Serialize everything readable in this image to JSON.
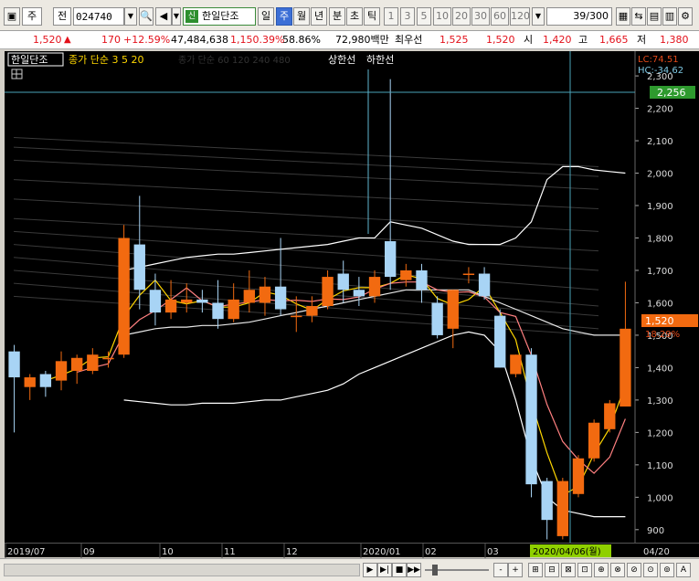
{
  "toolbar": {
    "market_label": "주",
    "type_label": "전",
    "code_value": "024740",
    "stock_name": "한일단조",
    "new_badge": "신",
    "periods": [
      "일",
      "주",
      "월",
      "년"
    ],
    "selected_period": "주",
    "minute_labels": [
      "분",
      "초",
      "틱"
    ],
    "intervals": [
      "1",
      "3",
      "5",
      "10",
      "20",
      "30",
      "60",
      "120"
    ],
    "count_value": "39/300"
  },
  "quote": {
    "price": "1,520",
    "change": "170",
    "change_pct": "+12.59%",
    "volume": "47,484,638",
    "volume_ratio": "1,150.39%",
    "turnover": "58.86%",
    "amount": "72,980백만",
    "best_ask_label": "최우선",
    "best_ask": "1,525",
    "best_bid": "1,520",
    "open_label": "시",
    "open": "1,420",
    "high_label": "고",
    "high": "1,665",
    "low_label": "저",
    "low": "1,380"
  },
  "legend": {
    "name": "한일단조",
    "ma_label": "종가 단순 3 5 20",
    "ma_label2": "종가 단순 60 120 240 480",
    "upper": "상한선",
    "lower": "하한선"
  },
  "axis_info": {
    "lc": "LC:74.51",
    "hc": "HC:-34.62",
    "crosshair_price": "2,256",
    "current_price": "1,520",
    "current_pct": "18.29%",
    "crosshair_date": "2020/04/06(월)"
  },
  "chart_data": {
    "type": "candlestick",
    "period": "weekly",
    "ylim": [
      860,
      2320
    ],
    "y_ticks": [
      900,
      1000,
      1100,
      1200,
      1300,
      1400,
      1500,
      1600,
      1700,
      1800,
      1900,
      2000,
      2100,
      2200,
      2300
    ],
    "x_labels": [
      "2019/07",
      "09",
      "10",
      "11",
      "12",
      "2020/01",
      "02",
      "03",
      "04/20"
    ],
    "candles": [
      {
        "o": 1450,
        "h": 1470,
        "l": 1200,
        "c": 1370
      },
      {
        "o": 1340,
        "h": 1380,
        "l": 1300,
        "c": 1370
      },
      {
        "o": 1380,
        "h": 1390,
        "l": 1310,
        "c": 1340
      },
      {
        "o": 1360,
        "h": 1450,
        "l": 1330,
        "c": 1420
      },
      {
        "o": 1390,
        "h": 1440,
        "l": 1350,
        "c": 1430
      },
      {
        "o": 1390,
        "h": 1460,
        "l": 1380,
        "c": 1440
      },
      {
        "o": 1430,
        "h": 1450,
        "l": 1400,
        "c": 1430
      },
      {
        "o": 1440,
        "h": 1840,
        "l": 1430,
        "c": 1800
      },
      {
        "o": 1780,
        "h": 1930,
        "l": 1580,
        "c": 1640
      },
      {
        "o": 1640,
        "h": 1690,
        "l": 1530,
        "c": 1570
      },
      {
        "o": 1570,
        "h": 1670,
        "l": 1550,
        "c": 1610
      },
      {
        "o": 1600,
        "h": 1660,
        "l": 1570,
        "c": 1610
      },
      {
        "o": 1610,
        "h": 1640,
        "l": 1570,
        "c": 1600
      },
      {
        "o": 1600,
        "h": 1670,
        "l": 1520,
        "c": 1550
      },
      {
        "o": 1550,
        "h": 1660,
        "l": 1540,
        "c": 1610
      },
      {
        "o": 1600,
        "h": 1700,
        "l": 1570,
        "c": 1640
      },
      {
        "o": 1600,
        "h": 1680,
        "l": 1560,
        "c": 1650
      },
      {
        "o": 1650,
        "h": 1800,
        "l": 1560,
        "c": 1580
      },
      {
        "o": 1560,
        "h": 1620,
        "l": 1510,
        "c": 1560
      },
      {
        "o": 1560,
        "h": 1620,
        "l": 1540,
        "c": 1590
      },
      {
        "o": 1590,
        "h": 1700,
        "l": 1580,
        "c": 1680
      },
      {
        "o": 1690,
        "h": 1730,
        "l": 1600,
        "c": 1640
      },
      {
        "o": 1640,
        "h": 1680,
        "l": 1590,
        "c": 1620
      },
      {
        "o": 1620,
        "h": 1700,
        "l": 1600,
        "c": 1680
      },
      {
        "o": 1790,
        "h": 2290,
        "l": 1640,
        "c": 1680
      },
      {
        "o": 1670,
        "h": 1720,
        "l": 1650,
        "c": 1700
      },
      {
        "o": 1700,
        "h": 1720,
        "l": 1600,
        "c": 1640
      },
      {
        "o": 1600,
        "h": 1620,
        "l": 1490,
        "c": 1500
      },
      {
        "o": 1520,
        "h": 1640,
        "l": 1460,
        "c": 1640
      },
      {
        "o": 1690,
        "h": 1710,
        "l": 1660,
        "c": 1690
      },
      {
        "o": 1690,
        "h": 1710,
        "l": 1610,
        "c": 1620
      },
      {
        "o": 1560,
        "h": 1580,
        "l": 1400,
        "c": 1400
      },
      {
        "o": 1380,
        "h": 1440,
        "l": 1370,
        "c": 1440
      },
      {
        "o": 1440,
        "h": 1460,
        "l": 1000,
        "c": 1040
      },
      {
        "o": 1050,
        "h": 1060,
        "l": 870,
        "c": 930
      },
      {
        "o": 880,
        "h": 1060,
        "l": 870,
        "c": 1050
      },
      {
        "o": 1010,
        "h": 1130,
        "l": 1000,
        "c": 1120
      },
      {
        "o": 1120,
        "h": 1240,
        "l": 1110,
        "c": 1230
      },
      {
        "o": 1210,
        "h": 1300,
        "l": 1200,
        "c": 1290
      },
      {
        "o": 1280,
        "h": 1665,
        "l": 1280,
        "c": 1520
      }
    ],
    "bollinger_upper": [
      null,
      null,
      null,
      null,
      null,
      null,
      null,
      1700,
      1710,
      1720,
      1730,
      1740,
      1745,
      1750,
      1750,
      1755,
      1760,
      1765,
      1770,
      1775,
      1780,
      1790,
      1800,
      1800,
      1850,
      1840,
      1830,
      1810,
      1790,
      1780,
      1780,
      1780,
      1800,
      1850,
      1980,
      2020,
      2020,
      2010,
      2005,
      2000
    ],
    "bollinger_lower": [
      null,
      null,
      null,
      null,
      null,
      null,
      null,
      1300,
      1295,
      1290,
      1285,
      1285,
      1290,
      1290,
      1290,
      1295,
      1300,
      1300,
      1310,
      1320,
      1330,
      1350,
      1380,
      1400,
      1420,
      1440,
      1460,
      1480,
      1500,
      1510,
      1500,
      1450,
      1300,
      1120,
      1000,
      960,
      950,
      940,
      940,
      940
    ],
    "middle": [
      null,
      null,
      null,
      null,
      null,
      null,
      null,
      1500,
      1510,
      1520,
      1525,
      1525,
      1530,
      1530,
      1535,
      1540,
      1550,
      1560,
      1570,
      1580,
      1590,
      1600,
      1610,
      1620,
      1630,
      1640,
      1640,
      1640,
      1640,
      1640,
      1620,
      1600,
      1580,
      1560,
      1540,
      1520,
      1510,
      1500,
      1500,
      1500
    ]
  }
}
